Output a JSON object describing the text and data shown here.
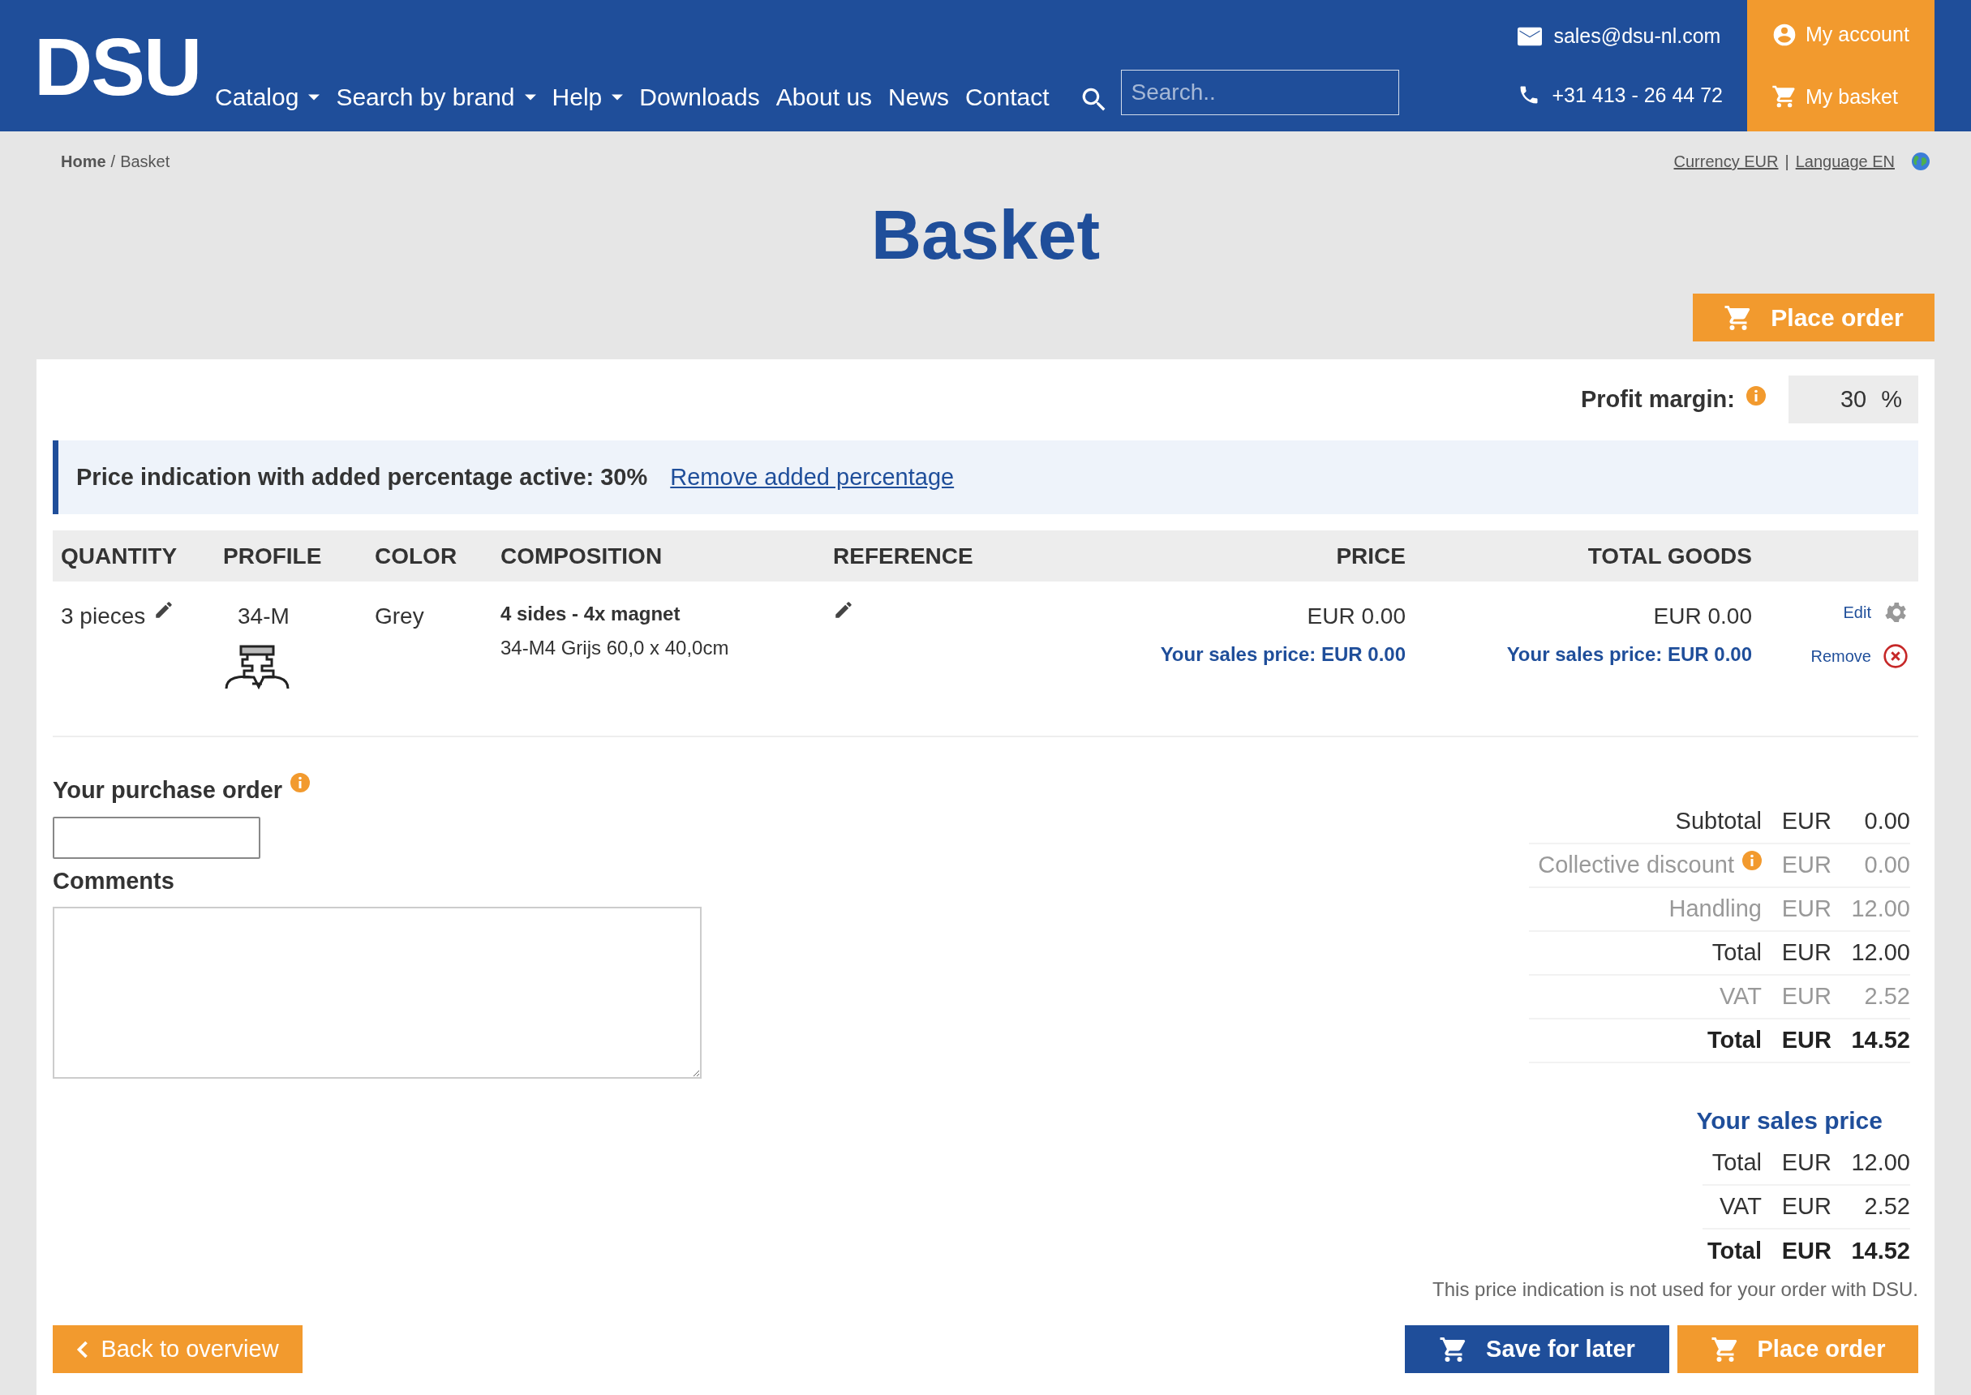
{
  "header": {
    "logo": "DSU",
    "nav": [
      {
        "label": "Catalog",
        "dropdown": true
      },
      {
        "label": "Search by brand",
        "dropdown": true
      },
      {
        "label": "Help",
        "dropdown": true
      },
      {
        "label": "Downloads",
        "dropdown": false
      },
      {
        "label": "About us",
        "dropdown": false
      },
      {
        "label": "News",
        "dropdown": false
      },
      {
        "label": "Contact",
        "dropdown": false
      }
    ],
    "search": {
      "placeholder": "Search.."
    },
    "email": "sales@dsu-nl.com",
    "phone": "+31 413 - 26 44 72",
    "account": "My account",
    "basket": "My basket"
  },
  "breadcrumb": [
    {
      "label": "Home",
      "current": false
    },
    {
      "label": "Basket",
      "current": true
    }
  ],
  "breadcrumb_separator": "/",
  "currency": "Currency EUR",
  "locale_separator": "|",
  "language": "Language EN",
  "title": "Basket",
  "place_order_top": "Place order",
  "profit_margin": {
    "label": "Profit margin:",
    "value": "30",
    "unit": "%"
  },
  "notice": {
    "text": "Price indication with added percentage active: 30%",
    "link": "Remove added percentage"
  },
  "table": {
    "columns": [
      {
        "label": "QUANTITY",
        "kind": "text"
      },
      {
        "label": "PROFILE",
        "kind": "text"
      },
      {
        "label": "COLOR",
        "kind": "text"
      },
      {
        "label": "COMPOSITION",
        "kind": "text"
      },
      {
        "label": "REFERENCE",
        "kind": "text"
      },
      {
        "label": "PRICE",
        "kind": "amount"
      },
      {
        "label": "TOTAL GOODS",
        "kind": "amount"
      }
    ],
    "rows": [
      {
        "quantity": "3 pieces",
        "profile": "34-M",
        "color_text": "Grey",
        "composition_title": "4 sides - 4x magnet",
        "composition_detail": "34-M4 Grijs 60,0 x 40,0cm",
        "price": "EUR 0.00",
        "price_sales": "Your sales price: EUR 0.00",
        "total": "EUR 0.00",
        "total_sales": "Your sales price: EUR 0.00",
        "edit": "Edit",
        "remove": "Remove"
      }
    ]
  },
  "purchase_order": {
    "label": "Your purchase order"
  },
  "comments": {
    "label": "Comments"
  },
  "totals": [
    {
      "label": "Subtotal",
      "currency": "EUR",
      "amount": "0.00",
      "kind": "normal",
      "info": false
    },
    {
      "label": "Collective discount",
      "currency": "EUR",
      "amount": "0.00",
      "kind": "muted",
      "info": true
    },
    {
      "label": "Handling",
      "currency": "EUR",
      "amount": "12.00",
      "kind": "muted",
      "info": false
    },
    {
      "label": "Total",
      "currency": "EUR",
      "amount": "12.00",
      "kind": "normal",
      "info": false
    },
    {
      "label": "VAT",
      "currency": "EUR",
      "amount": "2.52",
      "kind": "muted",
      "info": false
    },
    {
      "label": "Total",
      "currency": "EUR",
      "amount": "14.52",
      "kind": "bold",
      "info": false
    }
  ],
  "sales_price": {
    "heading": "Your sales price",
    "rows": [
      {
        "label": "Total",
        "currency": "EUR",
        "amount": "12.00",
        "kind": "normal"
      },
      {
        "label": "VAT",
        "currency": "EUR",
        "amount": "2.52",
        "kind": "normal"
      },
      {
        "label": "Total",
        "currency": "EUR",
        "amount": "14.52",
        "kind": "bold"
      }
    ]
  },
  "disclaimer": "This price indication is not used for your order with DSU.",
  "buttons": {
    "back": "Back to overview",
    "save": "Save for later",
    "place": "Place order"
  }
}
